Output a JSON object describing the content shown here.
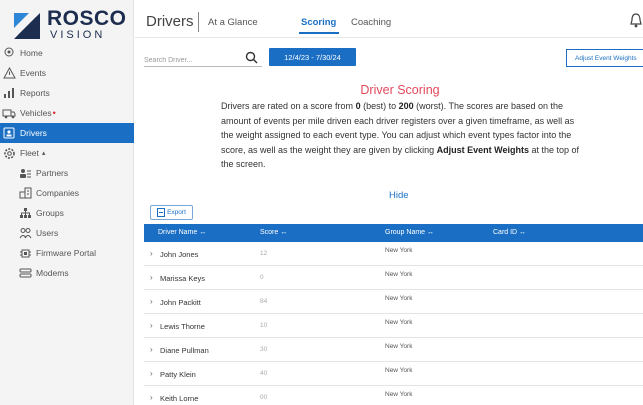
{
  "brand": {
    "name_top": "ROSCO",
    "name_bottom": "VISION"
  },
  "sidebar": {
    "items": [
      {
        "label": "Home",
        "icon": "home-pin-icon"
      },
      {
        "label": "Events",
        "icon": "warning-triangle-icon"
      },
      {
        "label": "Reports",
        "icon": "bar-chart-icon"
      },
      {
        "label": "Vehicles",
        "icon": "truck-icon",
        "badge": "•"
      },
      {
        "label": "Drivers",
        "icon": "driver-id-icon",
        "active": true
      },
      {
        "label": "Fleet",
        "icon": "gear-icon",
        "caret": "▴"
      },
      {
        "label": "Partners",
        "icon": "partners-icon",
        "sub": true
      },
      {
        "label": "Companies",
        "icon": "building-icon",
        "sub": true
      },
      {
        "label": "Groups",
        "icon": "sitemap-icon",
        "sub": true
      },
      {
        "label": "Users",
        "icon": "users-icon",
        "sub": true
      },
      {
        "label": "Firmware Portal",
        "icon": "chip-icon",
        "sub": true
      },
      {
        "label": "Modems",
        "icon": "modem-icon",
        "sub": true
      }
    ]
  },
  "header": {
    "title": "Drivers",
    "tabs": [
      {
        "label": "At a Glance"
      },
      {
        "label": "Scoring",
        "active": true
      },
      {
        "label": "Coaching"
      }
    ]
  },
  "toolbar": {
    "search_placeholder": "Search Driver...",
    "date_range": "12/4/23 - 7/30/24",
    "adjust_label": "Adjust Event Weights"
  },
  "info": {
    "title": "Driver Scoring",
    "p1": "Drivers are rated on a score from ",
    "best_score": "0",
    "p2": " (best) to ",
    "worst_score": "200",
    "p3": " (worst). The scores are based on the amount of events per mile driven each driver registers over a given timeframe, as well as the weight assigned to each event type. You can adjust which event types factor into the score, as well as the weight they are given by clicking ",
    "link_text": "Adjust Event Weights",
    "p4": " at the top of the screen.",
    "hide_label": "Hide"
  },
  "export_label": "Export",
  "table": {
    "columns": [
      "Driver Name ↔",
      "Score ↔",
      "Group Name ↔",
      "Card ID ↔"
    ],
    "rows": [
      {
        "name": "John Jones",
        "score": "12",
        "group": "New York"
      },
      {
        "name": "Marissa Keys",
        "score": "0",
        "group": "New York"
      },
      {
        "name": "John Packitt",
        "score": "84",
        "group": "New York"
      },
      {
        "name": "Lewis Thorne",
        "score": "10",
        "group": "New York"
      },
      {
        "name": "Diane Pullman",
        "score": "30",
        "group": "New York"
      },
      {
        "name": "Patty Klein",
        "score": "40",
        "group": "New York"
      },
      {
        "name": "Keith Lorne",
        "score": "00",
        "group": "New York"
      }
    ]
  },
  "colors": {
    "accent": "#1a6fc4",
    "title_red": "#e0485a",
    "sidebar_bg": "#f4f4f4"
  }
}
